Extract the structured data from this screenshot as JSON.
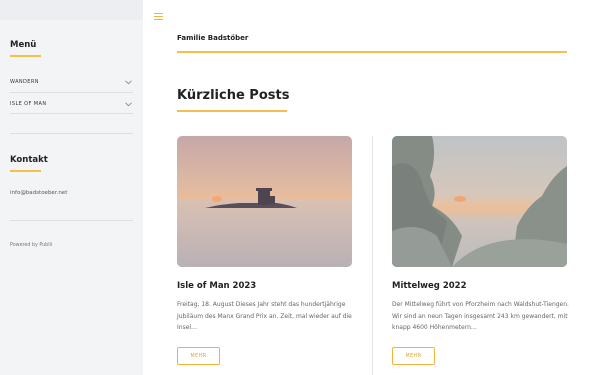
{
  "sidebar": {
    "menu_heading": "Menü",
    "items": [
      {
        "label": "WANDERN"
      },
      {
        "label": "ISLE OF MAN"
      }
    ],
    "contact_heading": "Kontakt",
    "email": "info@badstoeber.net",
    "powered_by": "Powered by Publii"
  },
  "header": {
    "site_title": "Familie Badstöber"
  },
  "main": {
    "section_title": "Kürzliche Posts",
    "posts": [
      {
        "title": "Isle of Man 2023",
        "excerpt": "Freitag, 18. August Dieses Jahr steht das hundertjährige Jubiläum des Manx Grand Prix an. Zeit, mal wieder auf die Insel…",
        "more_label": "MEHR"
      },
      {
        "title": "Mittelweg 2022",
        "excerpt": "Der Mittelweg führt von Pforzheim nach Waldshut-Tiengen. Wir sind an neun Tagen insgesamt 243 km gewandert, mit knapp 4600 Höhenmetern…",
        "more_label": "MEHR"
      }
    ]
  },
  "colors": {
    "accent": "#f5c04a",
    "sidebar_bg": "#f3f4f6"
  }
}
